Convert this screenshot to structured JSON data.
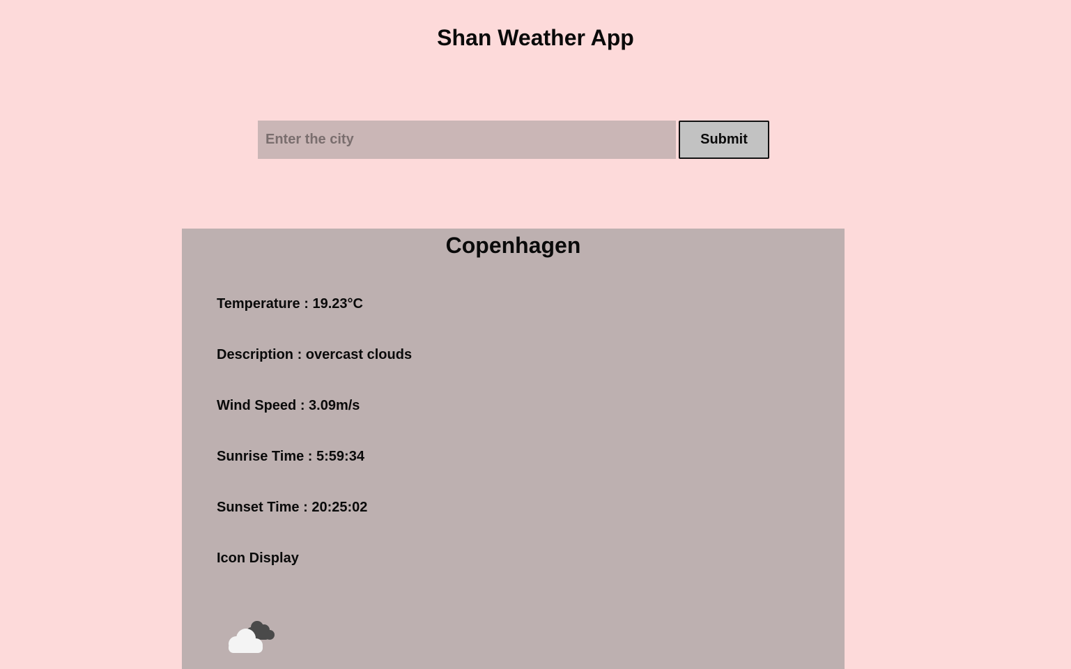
{
  "app": {
    "title": "Shan Weather App"
  },
  "search": {
    "placeholder": "Enter the city",
    "value": "",
    "submit_label": "Submit"
  },
  "weather": {
    "city": "Copenhagen",
    "temperature_line": "Temperature : 19.23°C",
    "description_line": "Description : overcast clouds",
    "wind_line": "Wind Speed : 3.09m/s",
    "sunrise_line": "Sunrise Time : 5:59:34",
    "sunset_line": "Sunset Time : 20:25:02",
    "icon_heading": "Icon Display",
    "icon": "overcast-clouds-icon"
  },
  "colors": {
    "page_background": "#fddada",
    "input_background": "#cab6b6",
    "button_background": "#c2c2c2",
    "card_background": "#bdb0b0"
  }
}
